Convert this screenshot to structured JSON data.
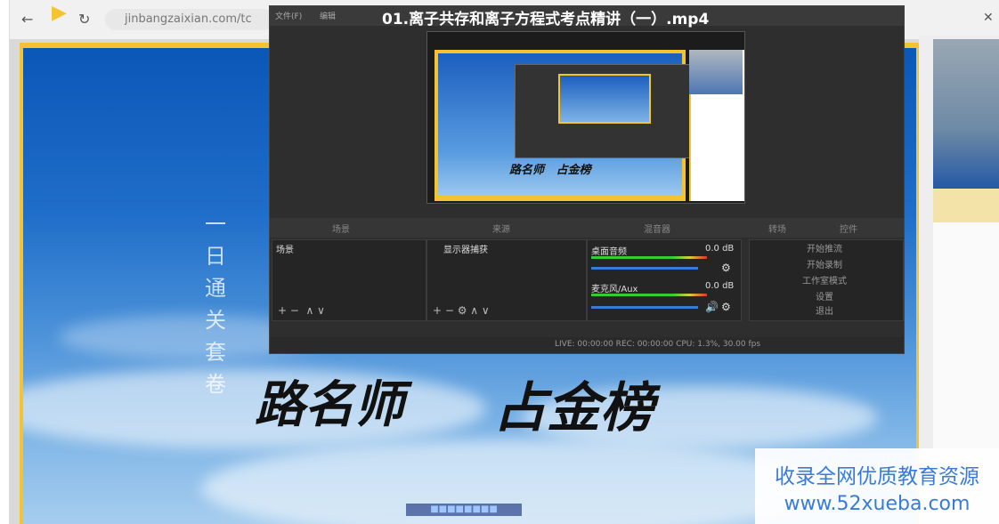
{
  "browser": {
    "url": "jinbangzaixian.com/tc",
    "back_icon": "back-arrow-icon",
    "reload_icon": "reload-icon"
  },
  "video": {
    "title": "01.离子共存和离子方程式考点精讲（一）.mp4",
    "vertical_text": "一日通关套卷",
    "teacher_line": "路名师",
    "slogan": "占金榜"
  },
  "obs": {
    "menu_items": [
      "文件(F)",
      "编辑"
    ],
    "dock_headers": [
      "场景",
      "来源",
      "混音器",
      "转场",
      "控件"
    ],
    "scenes_label": "场景",
    "sources_label": "显示器捕获",
    "mixer": [
      {
        "name": "桌面音频",
        "level": "0.0 dB"
      },
      {
        "name": "麦克风/Aux",
        "level": "0.0 dB"
      }
    ],
    "controls": [
      "开始推流",
      "开始录制",
      "工作室模式",
      "设置",
      "退出"
    ],
    "status": "LIVE: 00:00:00  REC: 00:00:00  CPU: 1.3%, 30.00 fps"
  },
  "watermark": {
    "line1": "收录全网优质教育资源",
    "line2": "www.52xueba.com"
  },
  "colors": {
    "accent_yellow": "#f4c430",
    "sky_blue": "#1f6ec9",
    "watermark_blue": "#3a7bd5"
  }
}
